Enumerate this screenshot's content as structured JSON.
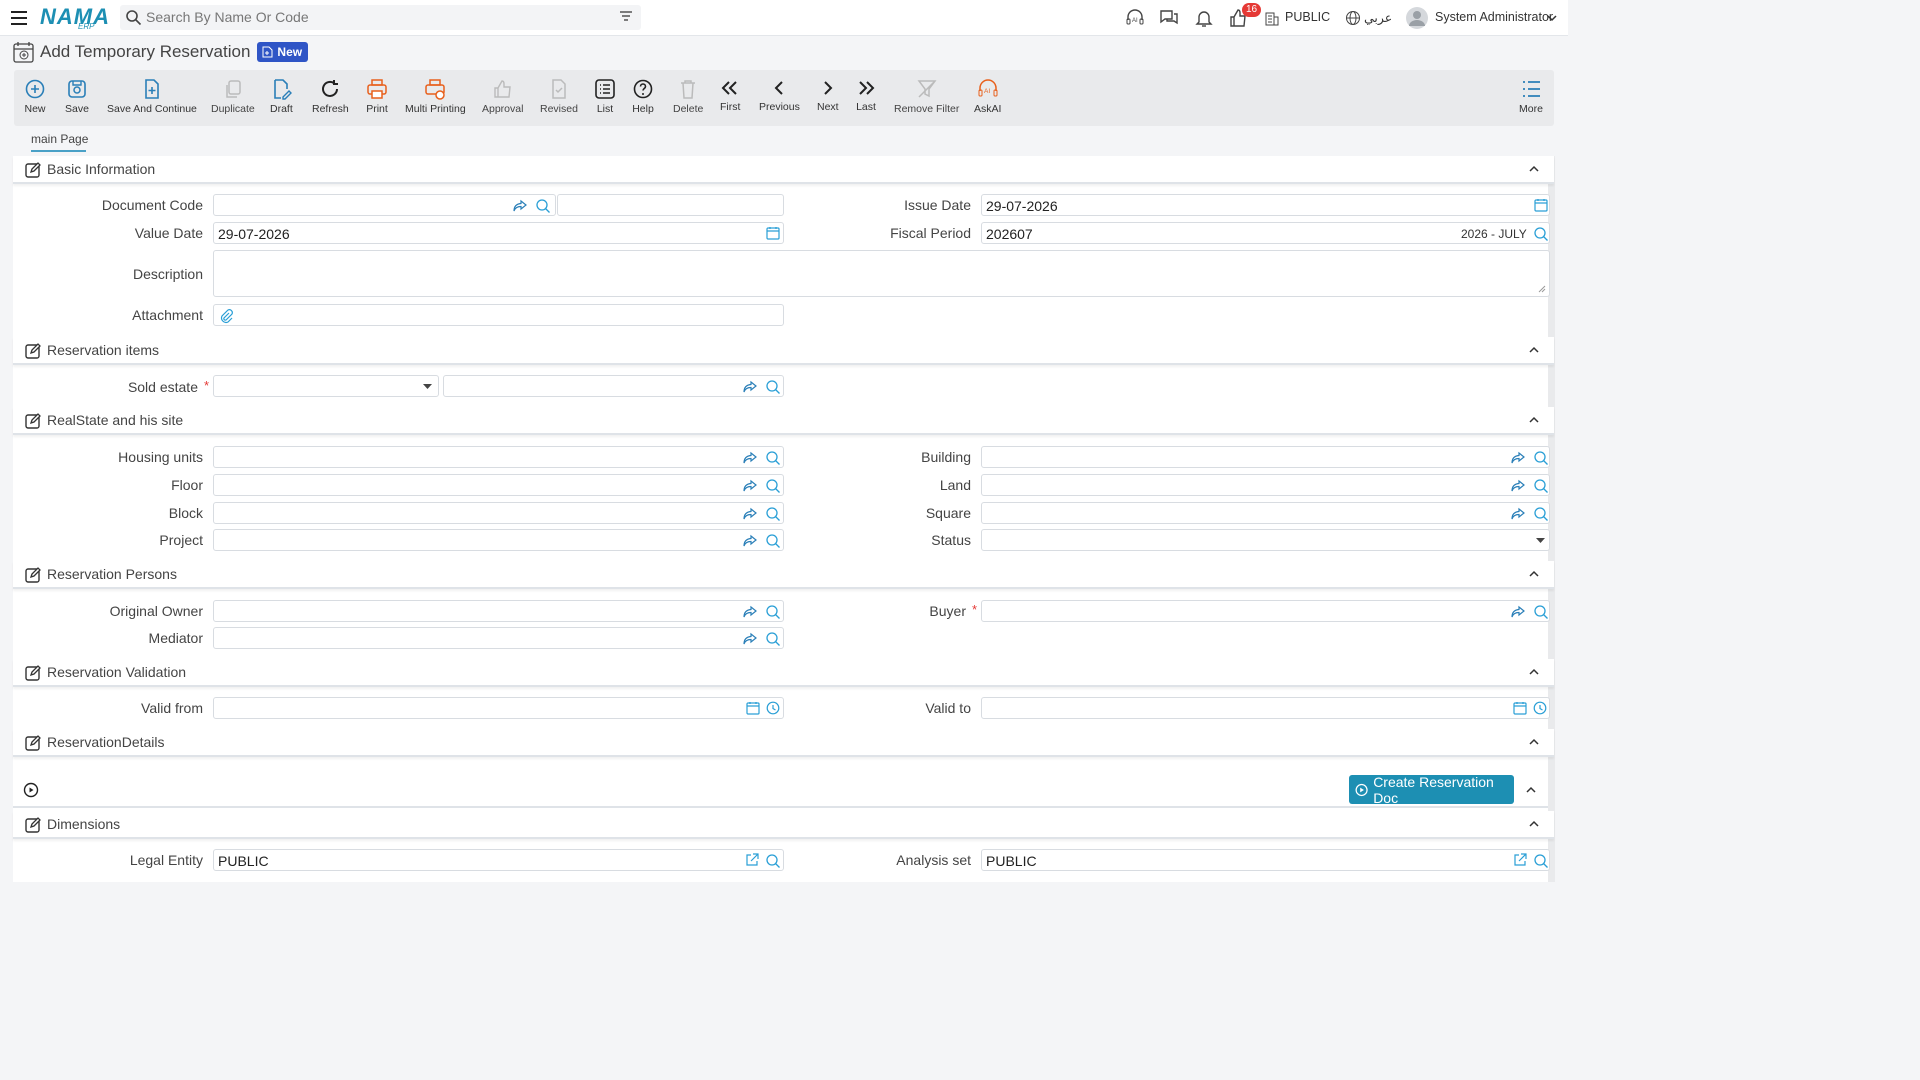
{
  "header": {
    "logo_text": "NAMA",
    "logo_sub": "ERP",
    "search_placeholder": "Search By Name Or Code",
    "notification_count": "16",
    "company": "PUBLIC",
    "language": "عربي",
    "user": "System Administrator"
  },
  "page": {
    "title": "Add Temporary Reservation",
    "status_badge": "New"
  },
  "toolbar": {
    "new": "New",
    "save": "Save",
    "save_continue": "Save And Continue",
    "duplicate": "Duplicate",
    "draft": "Draft",
    "refresh": "Refresh",
    "print": "Print",
    "multi_printing": "Multi Printing",
    "approval": "Approval",
    "revised": "Revised",
    "list": "List",
    "help": "Help",
    "delete": "Delete",
    "first": "First",
    "previous": "Previous",
    "next": "Next",
    "last": "Last",
    "remove_filter": "Remove Filter",
    "askai": "AskAI",
    "more": "More"
  },
  "tabs": {
    "main": "main Page"
  },
  "sections": {
    "basic": {
      "title": "Basic Information",
      "document_code_label": "Document Code",
      "issue_date_label": "Issue Date",
      "issue_date": "29-07-2026",
      "value_date_label": "Value Date",
      "value_date": "29-07-2026",
      "fiscal_period_label": "Fiscal Period",
      "fiscal_period": "202607",
      "fiscal_period_name": "2026 - JULY",
      "description_label": "Description",
      "attachment_label": "Attachment"
    },
    "items": {
      "title": "Reservation items",
      "sold_estate_label": "Sold estate"
    },
    "realstate": {
      "title": "RealState and his site",
      "housing_units_label": "Housing units",
      "building_label": "Building",
      "floor_label": "Floor",
      "land_label": "Land",
      "block_label": "Block",
      "square_label": "Square",
      "project_label": "Project",
      "status_label": "Status"
    },
    "persons": {
      "title": "Reservation Persons",
      "original_owner_label": "Original Owner",
      "buyer_label": "Buyer",
      "mediator_label": "Mediator"
    },
    "validation": {
      "title": "Reservation Validation",
      "valid_from_label": "Valid from",
      "valid_to_label": "Valid to"
    },
    "details": {
      "title": "ReservationDetails",
      "create_button": "Create Reservation Doc"
    },
    "dimensions": {
      "title": "Dimensions",
      "legal_entity_label": "Legal Entity",
      "legal_entity": "PUBLIC",
      "analysis_set_label": "Analysis set",
      "analysis_set": "PUBLIC"
    }
  },
  "required_mark": "*"
}
